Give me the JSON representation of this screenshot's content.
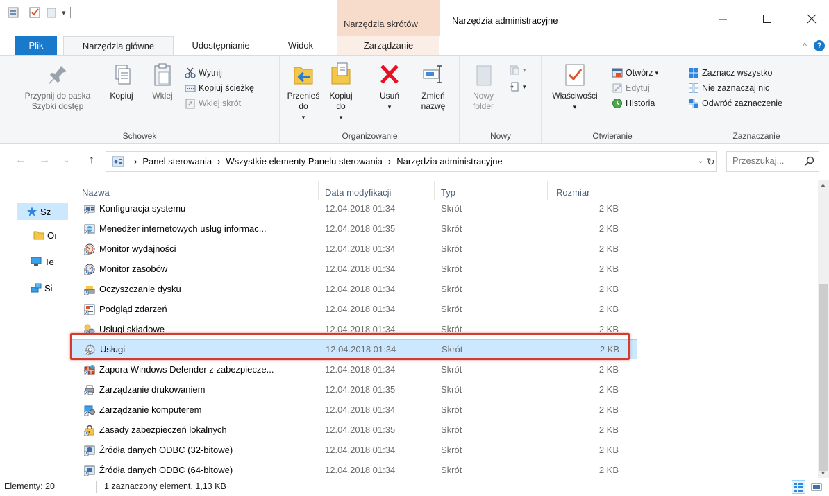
{
  "window": {
    "title": "Narzędzia administracyjne",
    "context_tab_header": "Narzędzia skrótów",
    "minimize": "—",
    "maximize": "☐",
    "close": "✕"
  },
  "tabs": {
    "file": "Plik",
    "home": "Narzędzia główne",
    "share": "Udostępnianie",
    "view": "Widok",
    "manage": "Zarządzanie",
    "collapse": "^",
    "help": "?"
  },
  "ribbon": {
    "clipboard": {
      "label": "Schowek",
      "pin": "Przypnij do paska Szybki dostęp",
      "copy": "Kopiuj",
      "paste": "Wklej",
      "cut": "Wytnij",
      "copy_path": "Kopiuj ścieżkę",
      "paste_shortcut": "Wklej skrót"
    },
    "organize": {
      "label": "Organizowanie",
      "move_to": "Przenieś do",
      "copy_to": "Kopiuj do",
      "delete": "Usuń",
      "rename": "Zmień nazwę"
    },
    "new": {
      "label": "Nowy",
      "new_folder": "Nowy folder"
    },
    "open": {
      "label": "Otwieranie",
      "properties": "Właściwości",
      "open": "Otwórz",
      "edit": "Edytuj",
      "history": "Historia"
    },
    "select": {
      "label": "Zaznaczanie",
      "select_all": "Zaznacz wszystko",
      "select_none": "Nie zaznaczaj nic",
      "invert": "Odwróć zaznaczenie"
    }
  },
  "address": {
    "crumbs": [
      "Panel sterowania",
      "Wszystkie elementy Panelu sterowania",
      "Narzędzia administracyjne"
    ],
    "search_placeholder": "Przeszukaj...",
    "search_value": ""
  },
  "navpane": {
    "items": [
      "Sz",
      "Oı",
      "Te",
      "Si"
    ]
  },
  "columns": {
    "name": "Nazwa",
    "date": "Data modyfikacji",
    "type": "Typ",
    "size": "Rozmiar"
  },
  "files": [
    {
      "name": "Konfiguracja systemu",
      "date": "12.04.2018 01:34",
      "type": "Skrót",
      "size": "2 KB",
      "icon": "system-config-icon"
    },
    {
      "name": "Menedżer internetowych usług informac...",
      "date": "12.04.2018 01:35",
      "type": "Skrót",
      "size": "2 KB",
      "icon": "iis-manager-icon"
    },
    {
      "name": "Monitor wydajności",
      "date": "12.04.2018 01:34",
      "type": "Skrót",
      "size": "2 KB",
      "icon": "performance-monitor-icon"
    },
    {
      "name": "Monitor zasobów",
      "date": "12.04.2018 01:34",
      "type": "Skrót",
      "size": "2 KB",
      "icon": "resource-monitor-icon"
    },
    {
      "name": "Oczyszczanie dysku",
      "date": "12.04.2018 01:34",
      "type": "Skrót",
      "size": "2 KB",
      "icon": "disk-cleanup-icon"
    },
    {
      "name": "Podgląd zdarzeń",
      "date": "12.04.2018 01:34",
      "type": "Skrót",
      "size": "2 KB",
      "icon": "event-viewer-icon"
    },
    {
      "name": "Usługi składowe",
      "date": "12.04.2018 01:34",
      "type": "Skrót",
      "size": "2 KB",
      "icon": "component-services-icon"
    },
    {
      "name": "Usługi",
      "date": "12.04.2018 01:34",
      "type": "Skrót",
      "size": "2 KB",
      "icon": "services-icon",
      "selected": true
    },
    {
      "name": "Zapora Windows Defender z zabezpiecze...",
      "date": "12.04.2018 01:34",
      "type": "Skrót",
      "size": "2 KB",
      "icon": "firewall-icon"
    },
    {
      "name": "Zarządzanie drukowaniem",
      "date": "12.04.2018 01:35",
      "type": "Skrót",
      "size": "2 KB",
      "icon": "print-management-icon"
    },
    {
      "name": "Zarządzanie komputerem",
      "date": "12.04.2018 01:34",
      "type": "Skrót",
      "size": "2 KB",
      "icon": "computer-management-icon"
    },
    {
      "name": "Zasady zabezpieczeń lokalnych",
      "date": "12.04.2018 01:35",
      "type": "Skrót",
      "size": "2 KB",
      "icon": "local-security-policy-icon"
    },
    {
      "name": "Źródła danych ODBC (32-bitowe)",
      "date": "12.04.2018 01:34",
      "type": "Skrót",
      "size": "2 KB",
      "icon": "odbc-icon"
    },
    {
      "name": "Źródła danych ODBC (64-bitowe)",
      "date": "12.04.2018 01:34",
      "type": "Skrót",
      "size": "2 KB",
      "icon": "odbc-icon"
    }
  ],
  "status": {
    "count": "Elementy: 20",
    "selection": "1 zaznaczony element, 1,13 KB"
  },
  "colors": {
    "accent": "#1979ca",
    "selection_bg": "#cce8ff",
    "highlight_border": "#d33b2f",
    "context_tab": "#f7dccb"
  }
}
